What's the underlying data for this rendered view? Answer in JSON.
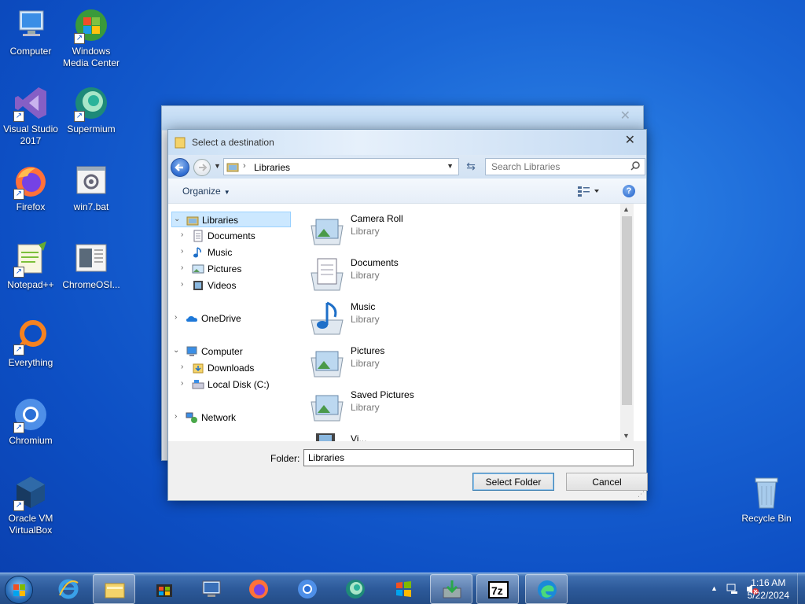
{
  "desktop": {
    "icons": [
      {
        "label": "Computer",
        "icon": "computer-icon"
      },
      {
        "label": "Windows Media Center",
        "icon": "media-center-icon"
      },
      {
        "label": "Visual Studio 2017",
        "icon": "visual-studio-icon"
      },
      {
        "label": "Supermium",
        "icon": "supermium-icon"
      },
      {
        "label": "Firefox",
        "icon": "firefox-icon"
      },
      {
        "label": "win7.bat",
        "icon": "batch-file-icon"
      },
      {
        "label": "Notepad++",
        "icon": "notepadpp-icon"
      },
      {
        "label": "ChromeOSI...",
        "icon": "document-icon"
      },
      {
        "label": "Everything",
        "icon": "everything-icon"
      },
      {
        "label": "Chromium",
        "icon": "chromium-icon"
      },
      {
        "label": "Oracle VM VirtualBox",
        "icon": "virtualbox-icon"
      },
      {
        "label": "Recycle Bin",
        "icon": "recycle-bin-icon"
      }
    ]
  },
  "dialog": {
    "title": "Select a destination",
    "address": {
      "crumb": "Libraries"
    },
    "search": {
      "placeholder": "Search Libraries"
    },
    "toolbar": {
      "organize": "Organize"
    },
    "tree": [
      {
        "label": "Libraries",
        "icon": "libraries-icon",
        "selected": true
      },
      {
        "label": "Documents",
        "icon": "documents-icon"
      },
      {
        "label": "Music",
        "icon": "music-icon"
      },
      {
        "label": "Pictures",
        "icon": "pictures-icon"
      },
      {
        "label": "Videos",
        "icon": "videos-icon"
      },
      {
        "label": "OneDrive",
        "icon": "onedrive-icon"
      },
      {
        "label": "Computer",
        "icon": "computer-icon"
      },
      {
        "label": "Downloads",
        "icon": "downloads-icon"
      },
      {
        "label": "Local Disk (C:)",
        "icon": "local-disk-icon"
      },
      {
        "label": "Network",
        "icon": "network-icon"
      }
    ],
    "items": [
      {
        "name": "Camera Roll",
        "type": "Library",
        "icon": "pictures-library-icon"
      },
      {
        "name": "Documents",
        "type": "Library",
        "icon": "documents-library-icon"
      },
      {
        "name": "Music",
        "type": "Library",
        "icon": "music-library-icon"
      },
      {
        "name": "Pictures",
        "type": "Library",
        "icon": "pictures-library-icon"
      },
      {
        "name": "Saved Pictures",
        "type": "Library",
        "icon": "pictures-library-icon"
      },
      {
        "name": "Vi...",
        "type": "",
        "icon": "videos-library-icon"
      }
    ],
    "footer": {
      "folder_label": "Folder:",
      "folder_value": "Libraries",
      "select_label": "Select Folder",
      "cancel_label": "Cancel"
    }
  },
  "taskbar": {
    "clock_time": "1:16 AM",
    "clock_date": "5/22/2024",
    "apps": [
      "internet-explorer-icon",
      "file-explorer-icon",
      "windows-store-icon",
      "remote-desktop-icon",
      "firefox-icon",
      "chromium-icon",
      "supermium-icon",
      "windows-logo-icon",
      "install-icon",
      "7zip-icon",
      "edge-icon"
    ]
  }
}
